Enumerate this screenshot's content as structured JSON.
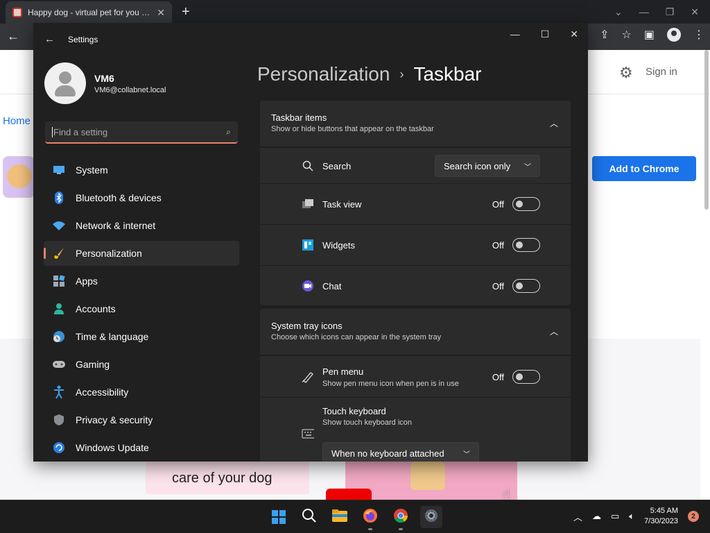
{
  "browser": {
    "tab_title": "Happy dog - virtual pet for you and...",
    "tab_close": "✕",
    "new_tab": "+",
    "store": {
      "signin": "Sign in",
      "home": "Home",
      "add_button": "Add to Chrome",
      "card_text": "care of your dog"
    }
  },
  "settings": {
    "window_title": "Settings",
    "user": {
      "name": "VM6",
      "email": "VM6@collabnet.local"
    },
    "search": {
      "placeholder": "Find a setting"
    },
    "nav": [
      {
        "label": "System",
        "icon": "monitor-icon"
      },
      {
        "label": "Bluetooth & devices",
        "icon": "bluetooth-icon"
      },
      {
        "label": "Network & internet",
        "icon": "wifi-icon"
      },
      {
        "label": "Personalization",
        "icon": "brush-icon",
        "active": true
      },
      {
        "label": "Apps",
        "icon": "apps-icon"
      },
      {
        "label": "Accounts",
        "icon": "person-icon"
      },
      {
        "label": "Time & language",
        "icon": "globe-clock-icon"
      },
      {
        "label": "Gaming",
        "icon": "gamepad-icon"
      },
      {
        "label": "Accessibility",
        "icon": "accessibility-icon"
      },
      {
        "label": "Privacy & security",
        "icon": "shield-icon"
      },
      {
        "label": "Windows Update",
        "icon": "update-icon"
      }
    ],
    "breadcrumb": {
      "parent": "Personalization",
      "separator": "›",
      "current": "Taskbar"
    },
    "taskbar_items": {
      "title": "Taskbar items",
      "subtitle": "Show or hide buttons that appear on the taskbar",
      "rows": [
        {
          "label": "Search",
          "value": "Search icon only"
        },
        {
          "label": "Task view",
          "state": "Off"
        },
        {
          "label": "Widgets",
          "state": "Off"
        },
        {
          "label": "Chat",
          "state": "Off"
        }
      ]
    },
    "system_tray": {
      "title": "System tray icons",
      "subtitle": "Choose which icons can appear in the system tray",
      "pen_menu": {
        "label": "Pen menu",
        "sub": "Show pen menu icon when pen is in use",
        "state": "Off"
      },
      "touch_keyboard": {
        "label": "Touch keyboard",
        "sub": "Show touch keyboard icon",
        "value": "When no keyboard attached"
      }
    }
  },
  "taskbar": {
    "time": "5:45 AM",
    "date": "7/30/2023",
    "notifications": "2"
  }
}
